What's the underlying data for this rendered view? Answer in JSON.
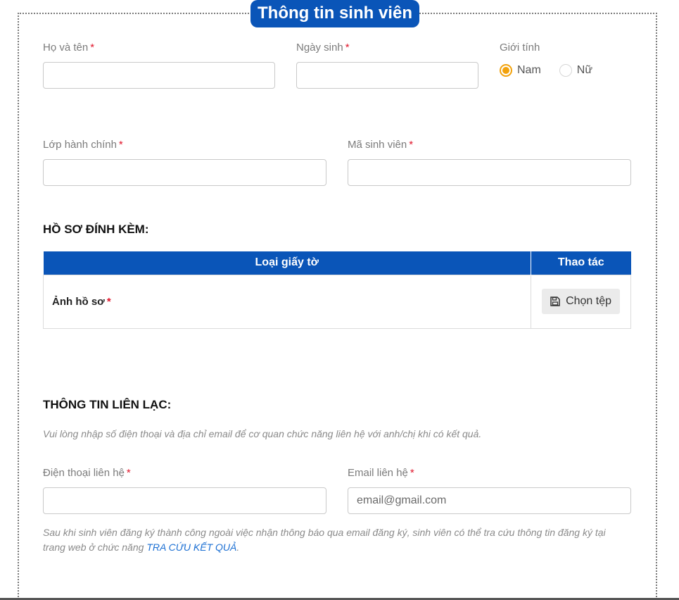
{
  "form": {
    "legend": "Thông tin sinh viên",
    "required_mark": "*",
    "fields": {
      "full_name": {
        "label": "Họ và tên",
        "value": ""
      },
      "birth_date": {
        "label": "Ngày sinh",
        "value": ""
      },
      "gender": {
        "label": "Giới tính",
        "options": [
          "Nam",
          "Nữ"
        ],
        "selected": "Nam"
      },
      "admin_class": {
        "label": "Lớp hành chính",
        "value": ""
      },
      "student_id": {
        "label": "Mã sinh viên",
        "value": ""
      }
    }
  },
  "attachments": {
    "title": "HỒ SƠ ĐÍNH KÈM:",
    "columns": [
      "Loại giấy tờ",
      "Thao tác"
    ],
    "rows": [
      {
        "doc_type": "Ảnh hồ sơ",
        "action_label": "Chọn tệp",
        "action_icon": "save-icon"
      }
    ]
  },
  "contact": {
    "title": "THÔNG TIN LIÊN LẠC:",
    "intro": "Vui lòng nhập số điện thoại và địa chỉ email để cơ quan chức năng liên hệ với anh/chị khi có kết quả.",
    "phone": {
      "label": "Điện thoại liên hệ",
      "value": ""
    },
    "email": {
      "label": "Email liên hệ",
      "placeholder": "email@gmail.com",
      "value": ""
    },
    "footer_note": {
      "text": "Sau khi sinh viên đăng ký thành công ngoài việc nhận thông báo qua email đăng ký, sinh viên có thể tra cứu thông tin đăng ký tại trang web ở chức năng ",
      "link": "TRA CỨU KẾT QUẢ",
      "end": "."
    }
  },
  "colors": {
    "primary": "#0a55b8",
    "accent": "#f2a20c",
    "required": "#e0162b",
    "link": "#1b6fd3"
  }
}
